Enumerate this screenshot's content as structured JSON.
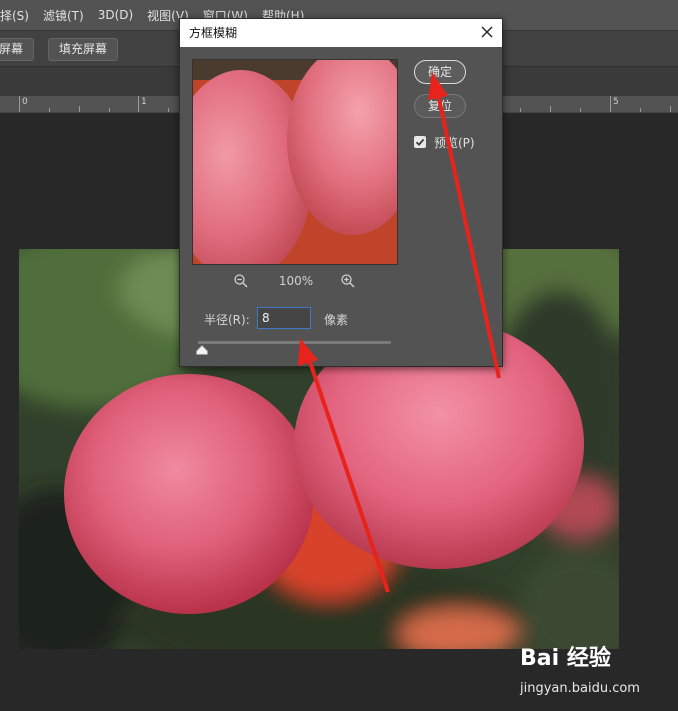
{
  "menu": {
    "items": [
      "择(S)",
      "滤镜(T)",
      "3D(D)",
      "视图(V)",
      "窗口(W)",
      "帮助(H)"
    ]
  },
  "options_bar": {
    "fit_screen_label": "屏幕",
    "fill_screen_label": "填充屏幕"
  },
  "ruler": {
    "labels": [
      "0",
      "1",
      "5"
    ]
  },
  "dialog": {
    "title": "方框模糊",
    "ok_label": "确定",
    "reset_label": "复位",
    "preview_label": "预览(P)",
    "preview_checked": true,
    "zoom_level": "100%",
    "radius_label": "半径(R):",
    "radius_value": "8",
    "unit_label": "像素",
    "slider_position": 0.02
  },
  "watermark": {
    "logo": "Bai 经验",
    "url": "jingyan.baidu.com"
  },
  "colors": {
    "menubar": "#535353",
    "panel": "#535353",
    "canvas_bg": "#282828",
    "focus_border": "#3f78c2",
    "arrow_red": "#e8231c"
  }
}
